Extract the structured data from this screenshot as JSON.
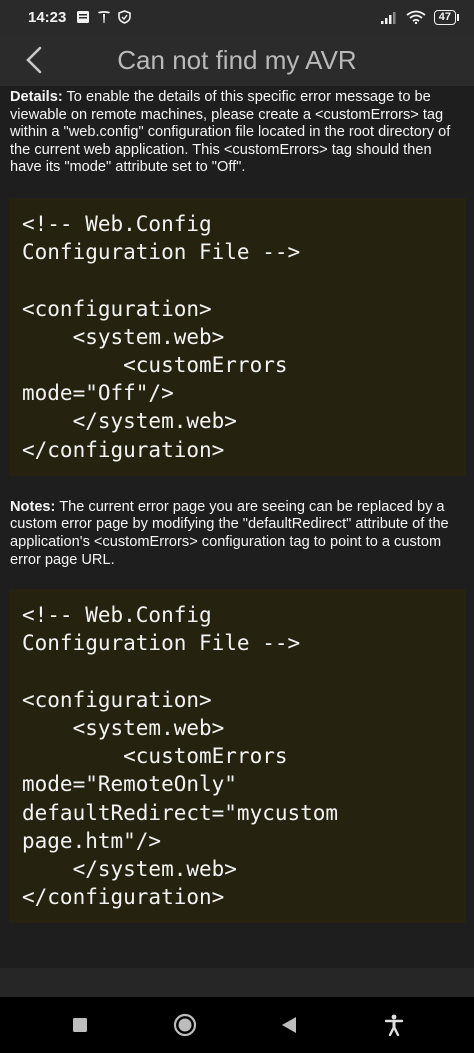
{
  "status_bar": {
    "time": "14:23",
    "battery": "47",
    "left_icons": [
      "note-icon",
      "tesla-icon",
      "shield-icon"
    ],
    "right_icons": [
      "signal-icon",
      "wifi-icon",
      "battery-icon"
    ]
  },
  "app_bar": {
    "title": "Can not find my AVR",
    "back_icon": "chevron-left-icon"
  },
  "details": {
    "label": "Details:",
    "text": " To enable the details of this specific error message to be viewable on remote machines, please create a <customErrors> tag within a \"web.config\" configuration file located in the root directory of the current web application. This <customErrors> tag should then have its \"mode\" attribute set to \"Off\"."
  },
  "code1": "<!-- Web.Config\nConfiguration File -->\n\n<configuration>\n    <system.web>\n        <customErrors\nmode=\"Off\"/>\n    </system.web>\n</configuration>",
  "notes": {
    "label": "Notes:",
    "text": " The current error page you are seeing can be replaced by a custom error page by modifying the \"defaultRedirect\" attribute of the application's <customErrors> configuration tag to point to a custom error page URL."
  },
  "code2": "<!-- Web.Config\nConfiguration File -->\n\n<configuration>\n    <system.web>\n        <customErrors\nmode=\"RemoteOnly\"\ndefaultRedirect=\"mycustom\npage.htm\"/>\n    </system.web>\n</configuration>",
  "nav_bar": {
    "buttons": [
      "recents-square-icon",
      "home-circle-icon",
      "back-triangle-icon",
      "accessibility-icon"
    ]
  }
}
